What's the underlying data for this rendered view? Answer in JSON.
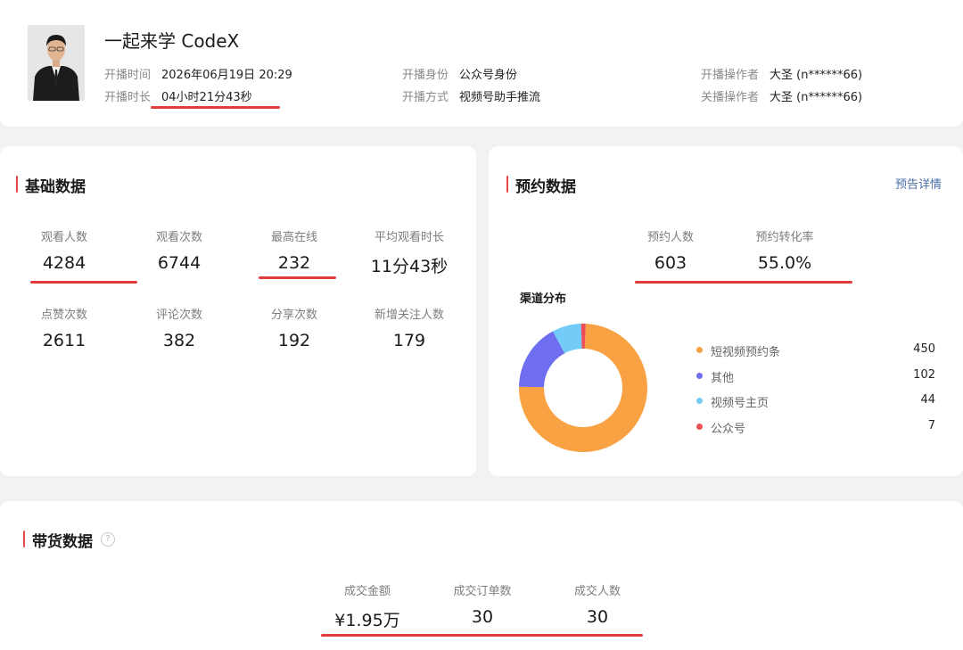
{
  "header": {
    "title": "一起来学 CodeX",
    "fields": [
      {
        "label": "开播时间",
        "value": "2026年06月19日 20:29"
      },
      {
        "label": "开播时长",
        "value": "04小时21分43秒"
      },
      {
        "label": "开播身份",
        "value": "公众号身份"
      },
      {
        "label": "开播方式",
        "value": "视频号助手推流"
      },
      {
        "label": "开播操作者",
        "value": "大圣 (n******66)"
      },
      {
        "label": "关播操作者",
        "value": "大圣 (n******66)"
      }
    ]
  },
  "basic": {
    "title": "基础数据",
    "stats": [
      {
        "label": "观看人数",
        "value": "4284"
      },
      {
        "label": "观看次数",
        "value": "6744"
      },
      {
        "label": "最高在线",
        "value": "232"
      },
      {
        "label": "平均观看时长",
        "value": "11分43秒"
      },
      {
        "label": "点赞次数",
        "value": "2611"
      },
      {
        "label": "评论次数",
        "value": "382"
      },
      {
        "label": "分享次数",
        "value": "192"
      },
      {
        "label": "新增关注人数",
        "value": "179"
      }
    ]
  },
  "reserve": {
    "title": "预约数据",
    "link": "预告详情",
    "stats": [
      {
        "label": "预约人数",
        "value": "603"
      },
      {
        "label": "预约转化率",
        "value": "55.0%"
      }
    ]
  },
  "chart_data": {
    "type": "pie",
    "title": "渠道分布",
    "categories": [
      "短视频预约条",
      "其他",
      "视频号主页",
      "公众号"
    ],
    "values": [
      450,
      102,
      44,
      7
    ],
    "colors": [
      "#f9a243",
      "#6f6ef0",
      "#72ccf7",
      "#ef4e56"
    ]
  },
  "sales": {
    "title": "带货数据",
    "help_icon": "?",
    "stats": [
      {
        "label": "成交金额",
        "value": "¥1.95万"
      },
      {
        "label": "成交订单数",
        "value": "30"
      },
      {
        "label": "成交人数",
        "value": "30"
      }
    ]
  },
  "colors": {
    "accent_red": "#e03c3c",
    "link_blue": "#4a6fa5"
  }
}
